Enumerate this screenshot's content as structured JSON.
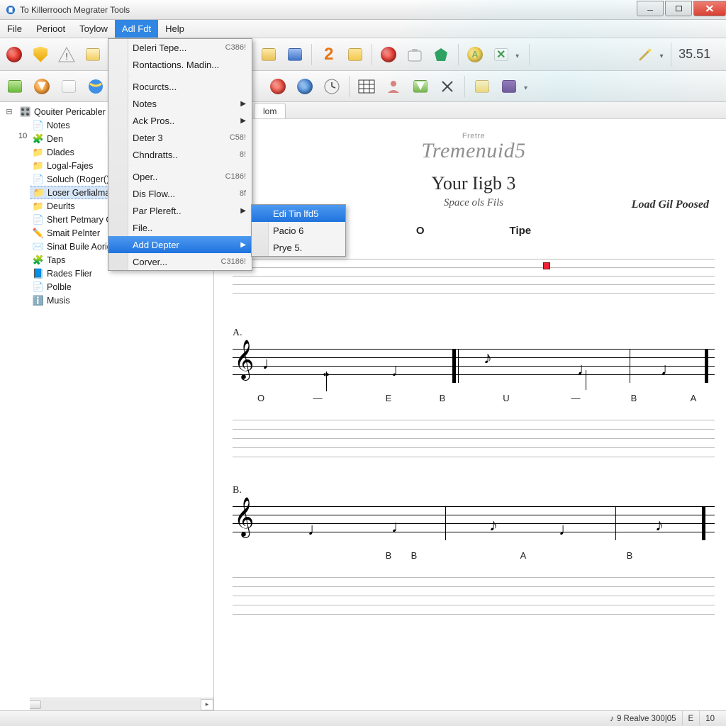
{
  "window": {
    "title": "To Killerrooch Megrater Tools"
  },
  "menubar": [
    "File",
    "Perioot",
    "Toylow",
    "Adl Fdt",
    "Help"
  ],
  "active_menu_index": 3,
  "menu": [
    {
      "label": "Deleri Tepe...",
      "shortcut": "C386!"
    },
    {
      "label": "Rontactions. Madin..."
    },
    {
      "sep": true
    },
    {
      "label": "Rocurcts..."
    },
    {
      "label": "Notes",
      "submenu": true
    },
    {
      "label": "Ack Pros..",
      "submenu": true
    },
    {
      "label": "Deter 3",
      "shortcut": "C58!"
    },
    {
      "label": "Chndratts..",
      "shortcut": "8!"
    },
    {
      "sep": true
    },
    {
      "label": "Oper..",
      "shortcut": "C186!"
    },
    {
      "label": "Dis Flow...",
      "shortcut": "8f"
    },
    {
      "label": "Par Plereft..",
      "submenu": true
    },
    {
      "label": "File.."
    },
    {
      "label": "Add Depter",
      "submenu": true,
      "highlight": true
    },
    {
      "label": "Corver...",
      "shortcut": "C3186!"
    }
  ],
  "submenu": [
    {
      "label": "Edi Tin lfd5",
      "highlight": true
    },
    {
      "label": "Pacio 6"
    },
    {
      "label": "Prye 5."
    }
  ],
  "toolbar_readout": "35.51",
  "tree": [
    {
      "twig": "minus",
      "icon": "🎛️",
      "label": "Qouiter Pericabler Sur",
      "root": true
    },
    {
      "twig": "none",
      "icon": "📄",
      "label": "Notes"
    },
    {
      "twig": "none",
      "icon": "🧩",
      "label": "Den"
    },
    {
      "twig": "plus",
      "icon": "📁",
      "label": "Dlades"
    },
    {
      "twig": "plus",
      "icon": "📁",
      "label": "Logal-Fajes"
    },
    {
      "twig": "none",
      "icon": "📄",
      "label": "Soluch (Roger()"
    },
    {
      "twig": "plus",
      "icon": "📁",
      "label": "Loser Gerlialma De",
      "selected": true
    },
    {
      "twig": "plus",
      "icon": "📁",
      "label": "Deurlts"
    },
    {
      "twig": "none",
      "icon": "📄",
      "label": "Shert Petmary Gitle"
    },
    {
      "twig": "none",
      "icon": "✏️",
      "label": "Smait Pelnter"
    },
    {
      "twig": "none",
      "icon": "✉️",
      "label": "Sinat Buile Aoright"
    },
    {
      "twig": "none",
      "icon": "🧩",
      "label": "Taps"
    },
    {
      "twig": "none",
      "icon": "📘",
      "label": "Rades Flier"
    },
    {
      "twig": "none",
      "icon": "📄",
      "label": "Polble"
    },
    {
      "twig": "none",
      "icon": "ℹ️",
      "label": "Musis"
    }
  ],
  "sidebar_page": "10",
  "doc_tab": "lom",
  "score": {
    "brand_small": "Fretre",
    "brand_big": "Tremenuid5",
    "title": "Your Iigb 3",
    "subtitle": "Space ols Fils",
    "info_right": "Load Gil Poosed",
    "col_left": "O",
    "col_right": "Tipe",
    "sectionA": {
      "label": "A.",
      "lyrics": [
        "O",
        "—",
        "E",
        "B",
        "U",
        "—",
        "B",
        "A"
      ]
    },
    "sectionB": {
      "label": "B.",
      "lyrics": [
        "B",
        "B",
        "A",
        "B"
      ]
    }
  },
  "status": {
    "center": "9 Realve 300|05",
    "right1": "E",
    "right2": "10"
  }
}
